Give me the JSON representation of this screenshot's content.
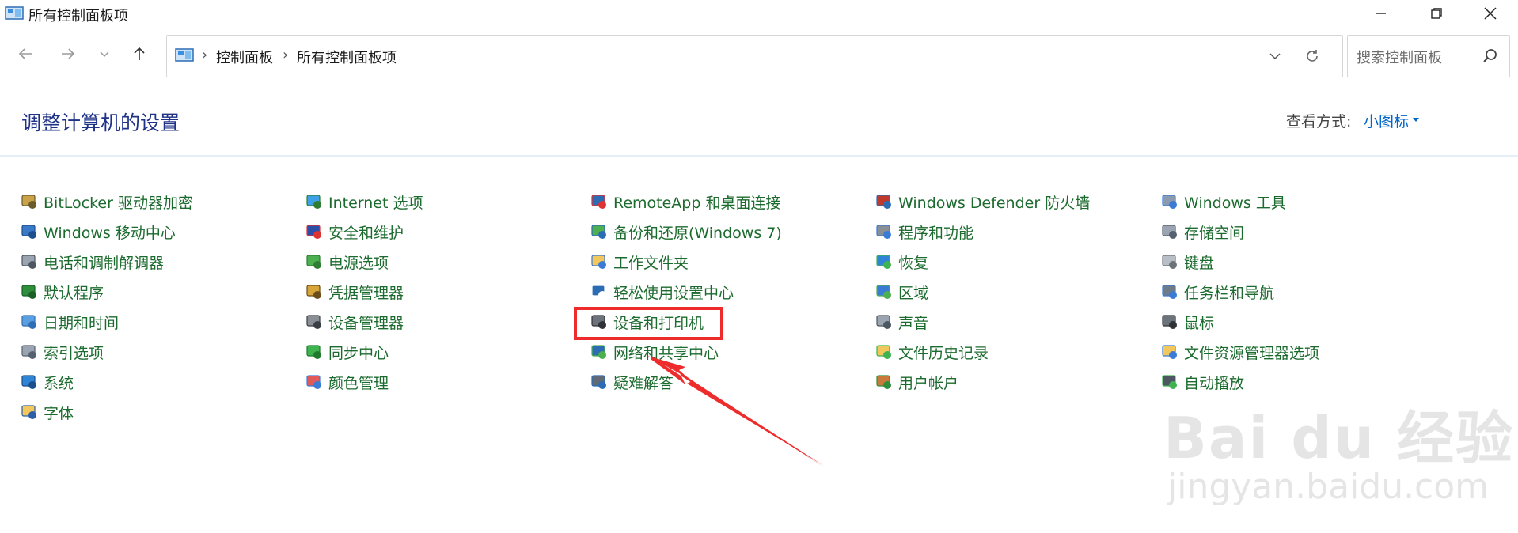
{
  "window": {
    "title": "所有控制面板项"
  },
  "address_bar": {
    "crumbs": [
      "控制面板",
      "所有控制面板项"
    ],
    "separator": "›"
  },
  "search": {
    "placeholder": "搜索控制面板"
  },
  "header": {
    "title": "调整计算机的设置",
    "view_label": "查看方式:",
    "view_value": "小图标"
  },
  "columns": [
    {
      "items": [
        {
          "label": "BitLocker 驱动器加密",
          "icon": "bitlocker-key-icon"
        },
        {
          "label": "Windows 移动中心",
          "icon": "mobility-center-icon"
        },
        {
          "label": "电话和调制解调器",
          "icon": "phone-modem-icon"
        },
        {
          "label": "默认程序",
          "icon": "default-programs-icon"
        },
        {
          "label": "日期和时间",
          "icon": "date-time-icon"
        },
        {
          "label": "索引选项",
          "icon": "indexing-icon"
        },
        {
          "label": "系统",
          "icon": "system-monitor-icon"
        },
        {
          "label": "字体",
          "icon": "fonts-folder-icon"
        }
      ]
    },
    {
      "items": [
        {
          "label": "Internet 选项",
          "icon": "internet-globe-icon"
        },
        {
          "label": "安全和维护",
          "icon": "security-flag-icon"
        },
        {
          "label": "电源选项",
          "icon": "power-options-icon"
        },
        {
          "label": "凭据管理器",
          "icon": "credential-vault-icon"
        },
        {
          "label": "设备管理器",
          "icon": "device-manager-icon"
        },
        {
          "label": "同步中心",
          "icon": "sync-center-icon"
        },
        {
          "label": "颜色管理",
          "icon": "color-management-icon"
        }
      ]
    },
    {
      "items": [
        {
          "label": "RemoteApp 和桌面连接",
          "icon": "remoteapp-icon"
        },
        {
          "label": "备份和还原(Windows 7)",
          "icon": "backup-restore-icon"
        },
        {
          "label": "工作文件夹",
          "icon": "work-folders-icon"
        },
        {
          "label": "轻松使用设置中心",
          "icon": "ease-of-access-icon"
        },
        {
          "label": "设备和打印机",
          "icon": "devices-printers-icon"
        },
        {
          "label": "网络和共享中心",
          "icon": "network-sharing-icon"
        },
        {
          "label": "疑难解答",
          "icon": "troubleshooting-icon"
        }
      ]
    },
    {
      "items": [
        {
          "label": "Windows Defender 防火墙",
          "icon": "firewall-icon"
        },
        {
          "label": "程序和功能",
          "icon": "programs-features-icon"
        },
        {
          "label": "恢复",
          "icon": "recovery-icon"
        },
        {
          "label": "区域",
          "icon": "region-globe-icon"
        },
        {
          "label": "声音",
          "icon": "sound-speaker-icon"
        },
        {
          "label": "文件历史记录",
          "icon": "file-history-icon"
        },
        {
          "label": "用户帐户",
          "icon": "user-accounts-icon"
        }
      ]
    },
    {
      "items": [
        {
          "label": "Windows 工具",
          "icon": "windows-tools-icon"
        },
        {
          "label": "存储空间",
          "icon": "storage-spaces-icon"
        },
        {
          "label": "键盘",
          "icon": "keyboard-icon"
        },
        {
          "label": "任务栏和导航",
          "icon": "taskbar-icon"
        },
        {
          "label": "鼠标",
          "icon": "mouse-icon"
        },
        {
          "label": "文件资源管理器选项",
          "icon": "explorer-options-icon"
        },
        {
          "label": "自动播放",
          "icon": "autoplay-icon"
        }
      ]
    }
  ],
  "annotation": {
    "highlighted_item": "设备和打印机",
    "color": "#ee2c2c"
  },
  "watermark": {
    "main": "Bai du 经验",
    "sub": "jingyan.baidu.com"
  },
  "colors": {
    "link_green": "#1c6b2e",
    "heading_blue": "#1e3287",
    "accent_blue": "#0066cc"
  }
}
